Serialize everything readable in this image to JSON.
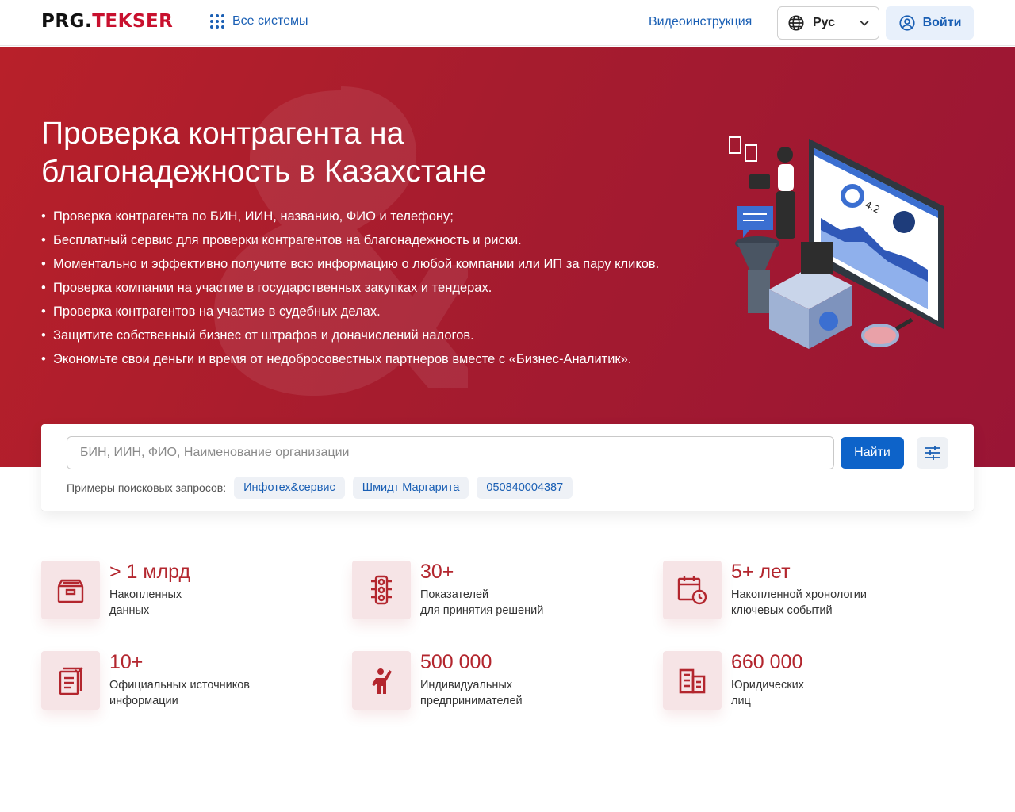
{
  "header": {
    "logo_part1": "PRG.",
    "logo_part2": "TEKSER",
    "all_systems": "Все системы",
    "video_instructions": "Видеоинструкция",
    "language": "Рус",
    "login": "Войти"
  },
  "hero": {
    "title_line1": "Проверка контрагента на",
    "title_line2": "благонадежность в Казахстане",
    "bullets": [
      "Проверка контрагента по БИН, ИИН, названию, ФИО и телефону;",
      "Бесплатный сервис для проверки контрагентов на благонадежность и риски.",
      "Моментально и эффективно получите всю информацию о любой компании или ИП за пару кликов.",
      "Проверка компании на участие в государственных закупках и тендерах.",
      "Проверка контрагентов на участие в судебных делах.",
      "Защитите собственный бизнес от штрафов и доначислений налогов.",
      "Экономьте свои деньги и время от недобросовестных партнеров вместе с «Бизнес-Аналитик»."
    ]
  },
  "search": {
    "placeholder": "БИН, ИИН, ФИО, Наименование организации",
    "button": "Найти",
    "examples_label": "Примеры поисковых запросов:",
    "examples": [
      "Инфотех&сервис",
      "Шмидт Маргарита",
      "050840004387"
    ]
  },
  "stats": [
    {
      "value": "> 1 млрд",
      "line1": "Накопленных",
      "line2": "данных",
      "icon": "archive-box-icon"
    },
    {
      "value": "30+",
      "line1": "Показателей",
      "line2": "для принятия решений",
      "icon": "traffic-light-icon"
    },
    {
      "value": "5+ лет",
      "line1": "Накопленной хронологии",
      "line2": "ключевых событий",
      "icon": "calendar-clock-icon"
    },
    {
      "value": "10+",
      "line1": "Официальных источников",
      "line2": "информации",
      "icon": "documents-check-icon"
    },
    {
      "value": "500 000",
      "line1": "Индивидуальных",
      "line2": "предпринимателей",
      "icon": "person-raising-hand-icon"
    },
    {
      "value": "660 000",
      "line1": "Юридических",
      "line2": "лиц",
      "icon": "building-icon"
    }
  ],
  "colors": {
    "brand_red": "#c8102e",
    "hero_red": "#a61c2e",
    "link_blue": "#1a5fb4",
    "button_blue": "#0d63c9",
    "stat_value_red": "#b3262e"
  }
}
